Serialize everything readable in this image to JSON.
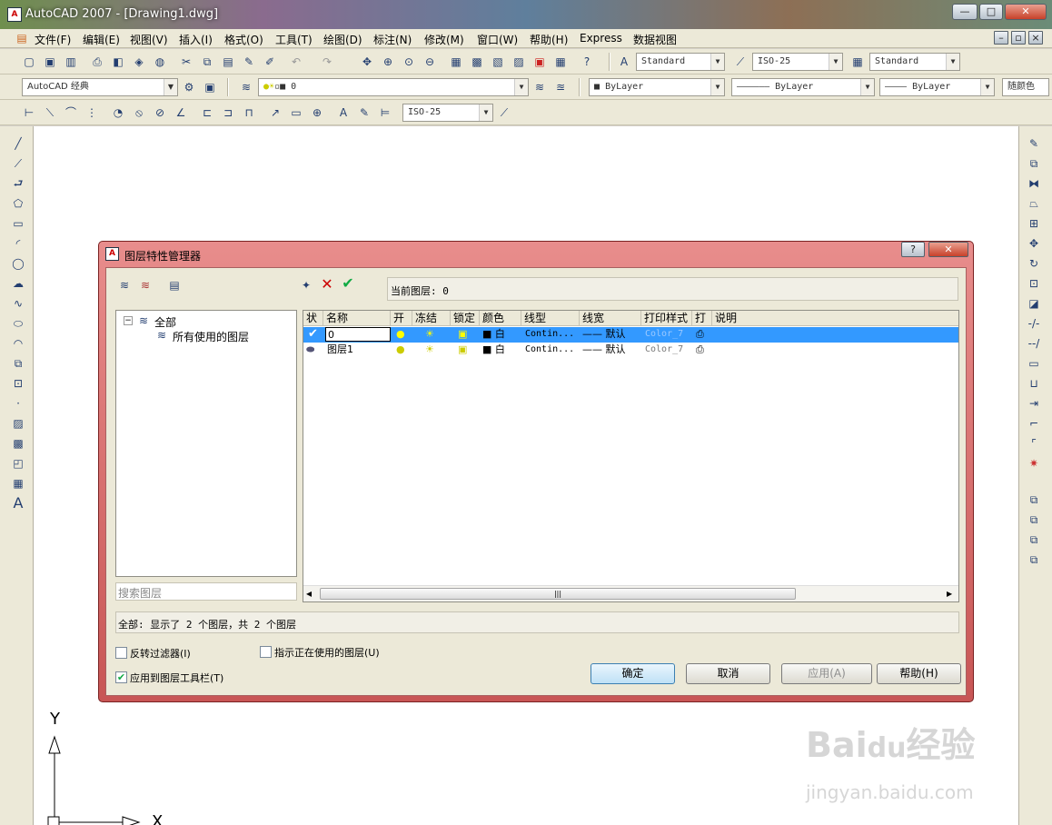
{
  "window": {
    "title": "AutoCAD 2007 - [Drawing1.dwg]",
    "app_icon": "AutoCAD"
  },
  "menu": [
    "文件(F)",
    "编辑(E)",
    "视图(V)",
    "插入(I)",
    "格式(O)",
    "工具(T)",
    "绘图(D)",
    "标注(N)",
    "修改(M)",
    "窗口(W)",
    "帮助(H)",
    "Express",
    "数据视图"
  ],
  "toolbar1": {
    "text_style": "Standard",
    "dim_style": "ISO-25",
    "table_style": "Standard"
  },
  "toolbar2": {
    "workspace": "AutoCAD 经典",
    "layer": "0",
    "color": "ByLayer",
    "linetype": "ByLayer",
    "lineweight": "ByLayer",
    "plotstyle": "随颜色"
  },
  "toolbar3": {
    "dim_style": "ISO-25"
  },
  "dialog": {
    "title": "图层特性管理器",
    "current_layer": "当前图层: 0",
    "tree": {
      "root": "全部",
      "child": "所有使用的图层"
    },
    "search_placeholder": "搜索图层",
    "columns": [
      "状",
      "名称",
      "开",
      "冻结",
      "锁定",
      "颜色",
      "线型",
      "线宽",
      "打印样式",
      "打",
      "说明"
    ],
    "layers": [
      {
        "name": "0",
        "color": "白",
        "linetype": "Contin...",
        "lineweight": "—— 默认",
        "plotstyle": "Color_7",
        "selected": true
      },
      {
        "name": "图层1",
        "color": "白",
        "linetype": "Contin...",
        "lineweight": "—— 默认",
        "plotstyle": "Color_7",
        "selected": false
      }
    ],
    "status": "全部: 显示了 2 个图层，共 2 个图层",
    "invert_filter": "反转过滤器(I)",
    "indicate_in_use": "指示正在使用的图层(U)",
    "apply_to_toolbar": "应用到图层工具栏(T)",
    "buttons": {
      "ok": "确定",
      "cancel": "取消",
      "apply": "应用(A)",
      "help": "帮助(H)"
    }
  },
  "ucs": {
    "x": "X",
    "y": "Y"
  },
  "watermark": "Baidu经验 jingyan.baidu.com",
  "colors": {
    "selection": "#3399ff",
    "dialog_frame": "#d66e6d"
  }
}
